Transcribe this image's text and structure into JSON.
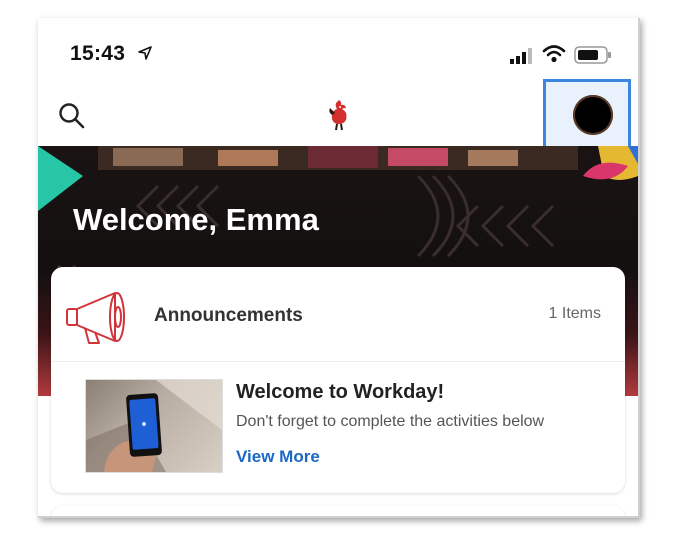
{
  "status_bar": {
    "time": "15:43",
    "location_icon": "location-arrow-icon",
    "signal_icon": "cellular-signal-icon",
    "wifi_icon": "wifi-icon",
    "battery_icon": "battery-icon"
  },
  "nav": {
    "search_icon": "search-icon",
    "logo_icon": "rooster-logo-icon",
    "avatar_icon": "avatar"
  },
  "hero": {
    "welcome_text": "Welcome, Emma"
  },
  "announcements": {
    "icon": "megaphone-icon",
    "title": "Announcements",
    "count_label": "1 Items",
    "items": [
      {
        "thumbnail": "phone-in-hand-image",
        "title": "Welcome to Workday!",
        "description": "Don't forget to complete the activities below",
        "link_label": "View More"
      }
    ]
  },
  "colors": {
    "accent_blue": "#1d67c4",
    "highlight_border": "#3d86e0",
    "brand_red": "#d0343a"
  }
}
